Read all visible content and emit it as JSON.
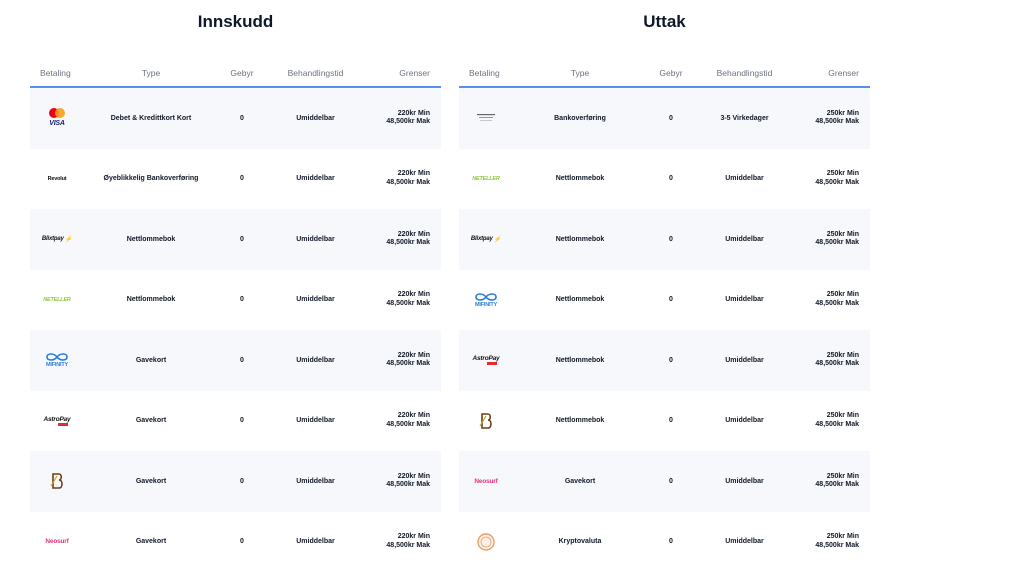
{
  "colors": {
    "accent_line": "#5b8def",
    "row_alt": "#f6f8fb",
    "neteller_green": "#8cc63f",
    "neosurf_pink": "#e6337a",
    "mifinity_blue": "#2a7ddb",
    "astropay_red": "#e32b2b",
    "mastercard_red": "#eb001b",
    "mastercard_orange": "#f79e1b",
    "visa_blue": "#1a1f71"
  },
  "deposits": {
    "title": "Innskudd",
    "headers": [
      "Betaling",
      "Type",
      "Gebyr",
      "Behandlingstid",
      "Grenser"
    ],
    "rows": [
      {
        "logo": "mastercard-visa",
        "logo_text": "VISA",
        "type": "Debet & Kredittkort Kort",
        "fee": "0",
        "time": "Umiddelbar",
        "min": "220kr Min",
        "max": "48,500kr Mak"
      },
      {
        "logo": "revolut",
        "logo_text": "Revolut",
        "type": "Øyeblikkelig Bankoverføring",
        "fee": "0",
        "time": "Umiddelbar",
        "min": "220kr Min",
        "max": "48,500kr Mak"
      },
      {
        "logo": "blixtpay",
        "logo_text": "Blixtpay",
        "type": "Nettlommebok",
        "fee": "0",
        "time": "Umiddelbar",
        "min": "220kr Min",
        "max": "48,500kr Mak"
      },
      {
        "logo": "neteller",
        "logo_text": "NETELLER",
        "type": "Nettlommebok",
        "fee": "0",
        "time": "Umiddelbar",
        "min": "220kr Min",
        "max": "48,500kr Mak"
      },
      {
        "logo": "mifinity",
        "logo_text": "MIFINITY",
        "type": "Gavekort",
        "fee": "0",
        "time": "Umiddelbar",
        "min": "220kr Min",
        "max": "48,500kr Mak"
      },
      {
        "logo": "astropay",
        "logo_text": "AstroPay",
        "type": "Gavekort",
        "fee": "0",
        "time": "Umiddelbar",
        "min": "220kr Min",
        "max": "48,500kr Mak"
      },
      {
        "logo": "b-coin",
        "logo_text": "",
        "type": "Gavekort",
        "fee": "0",
        "time": "Umiddelbar",
        "min": "220kr Min",
        "max": "48,500kr Mak"
      },
      {
        "logo": "neosurf",
        "logo_text": "Neosurf",
        "type": "Gavekort",
        "fee": "0",
        "time": "Umiddelbar",
        "min": "220kr Min",
        "max": "48,500kr Mak"
      }
    ]
  },
  "withdrawals": {
    "title": "Uttak",
    "headers": [
      "Betaling",
      "Type",
      "Gebyr",
      "Behandlingstid",
      "Grenser"
    ],
    "rows": [
      {
        "logo": "bank",
        "logo_text": "",
        "type": "Bankoverføring",
        "fee": "0",
        "time": "3-5 Virkedager",
        "min": "250kr Min",
        "max": "48,500kr Mak"
      },
      {
        "logo": "neteller",
        "logo_text": "NETELLER",
        "type": "Nettlommebok",
        "fee": "0",
        "time": "Umiddelbar",
        "min": "250kr Min",
        "max": "48,500kr Mak"
      },
      {
        "logo": "blixtpay",
        "logo_text": "Blixtpay",
        "type": "Nettlommebok",
        "fee": "0",
        "time": "Umiddelbar",
        "min": "250kr Min",
        "max": "48,500kr Mak"
      },
      {
        "logo": "mifinity",
        "logo_text": "MIFINITY",
        "type": "Nettlommebok",
        "fee": "0",
        "time": "Umiddelbar",
        "min": "250kr Min",
        "max": "48,500kr Mak"
      },
      {
        "logo": "astropay",
        "logo_text": "AstroPay",
        "type": "Nettlommebok",
        "fee": "0",
        "time": "Umiddelbar",
        "min": "250kr Min",
        "max": "48,500kr Mak"
      },
      {
        "logo": "b-coin",
        "logo_text": "",
        "type": "Nettlommebok",
        "fee": "0",
        "time": "Umiddelbar",
        "min": "250kr Min",
        "max": "48,500kr Mak"
      },
      {
        "logo": "neosurf",
        "logo_text": "Neosurf",
        "type": "Gavekort",
        "fee": "0",
        "time": "Umiddelbar",
        "min": "250kr Min",
        "max": "48,500kr Mak"
      },
      {
        "logo": "crypto",
        "logo_text": "",
        "type": "Kryptovaluta",
        "fee": "0",
        "time": "Umiddelbar",
        "min": "250kr Min",
        "max": "48,500kr Mak"
      }
    ]
  }
}
